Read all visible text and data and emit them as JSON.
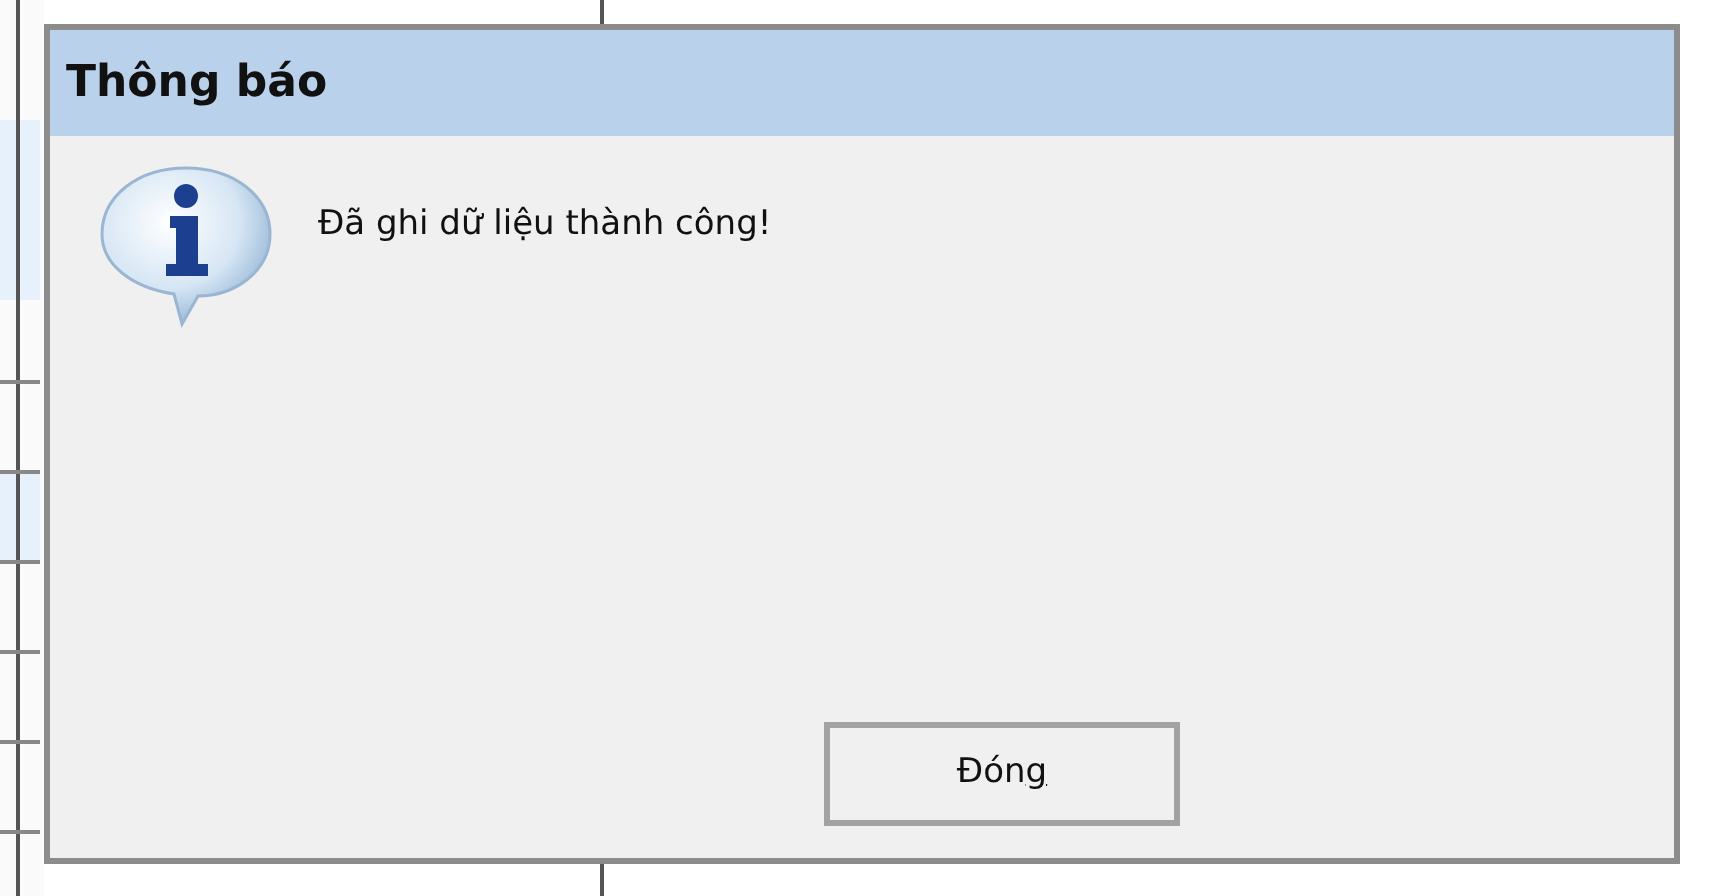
{
  "dialog": {
    "title": "Thông báo",
    "message": "Đã ghi dữ liệu thành công!",
    "button": {
      "label_before": "Đón",
      "mnemonic": "g"
    }
  }
}
